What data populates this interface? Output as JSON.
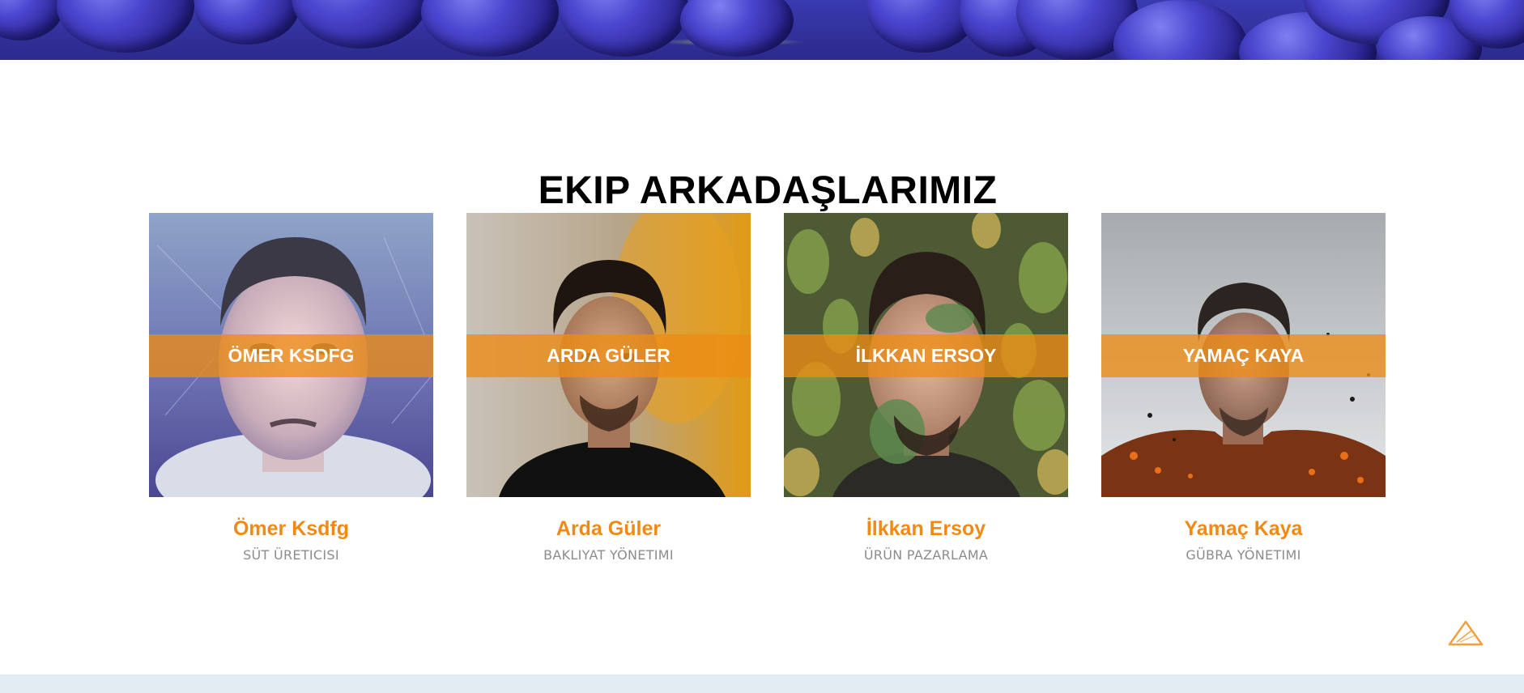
{
  "section": {
    "title": "EKIP ARKADAŞLARIMIZ"
  },
  "team": [
    {
      "band_label": "ÖMER KSDFG",
      "name": "Ömer Ksdfg",
      "role": "SÜT ÜRETICISI"
    },
    {
      "band_label": "ARDA GÜLER",
      "name": "Arda Güler",
      "role": "BAKLIYAT YÖNETIMI"
    },
    {
      "band_label": "İLKKAN ERSOY",
      "name": "İlkkan Ersoy",
      "role": "ÜRÜN PAZARLAMA"
    },
    {
      "band_label": "YAMAÇ KAYA",
      "name": "Yamaç Kaya",
      "role": "GÜBRA YÖNETIMI"
    }
  ],
  "icons": {
    "scroll_top": "triangle-up-icon"
  },
  "colors": {
    "accent": "#ef8a17",
    "band": "#ed8c14",
    "role_text": "#8c8c8c",
    "footer": "#e3ebf3"
  }
}
